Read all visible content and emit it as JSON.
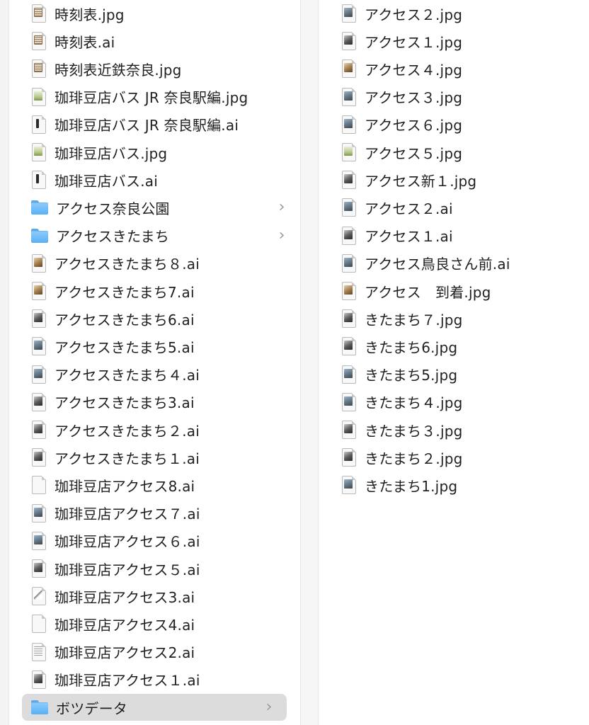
{
  "left_column": {
    "items": [
      {
        "name": "時刻表.jpg",
        "kind": "file",
        "thumb": "table"
      },
      {
        "name": "時刻表.ai",
        "kind": "file",
        "thumb": "table"
      },
      {
        "name": "時刻表近鉄奈良.jpg",
        "kind": "file",
        "thumb": "table"
      },
      {
        "name": "珈琲豆店バス JR 奈良駅編.jpg",
        "kind": "file",
        "thumb": "green"
      },
      {
        "name": "珈琲豆店バス JR 奈良駅編.ai",
        "kind": "file",
        "thumb": "bar"
      },
      {
        "name": "珈琲豆店バス.jpg",
        "kind": "file",
        "thumb": "green"
      },
      {
        "name": "珈琲豆店バス.ai",
        "kind": "file",
        "thumb": "bar"
      },
      {
        "name": "アクセス奈良公園",
        "kind": "folder",
        "chevron": "›"
      },
      {
        "name": "アクセスきたまち",
        "kind": "folder",
        "chevron": "›"
      },
      {
        "name": "アクセスきたまち８.ai",
        "kind": "file",
        "thumb": "tan"
      },
      {
        "name": "アクセスきたまち7.ai",
        "kind": "file",
        "thumb": "tan"
      },
      {
        "name": "アクセスきたまち6.ai",
        "kind": "file",
        "thumb": "dark"
      },
      {
        "name": "アクセスきたまち5.ai",
        "kind": "file",
        "thumb": "photo"
      },
      {
        "name": "アクセスきたまち４.ai",
        "kind": "file",
        "thumb": "photo"
      },
      {
        "name": "アクセスきたまち3.ai",
        "kind": "file",
        "thumb": "dark"
      },
      {
        "name": "アクセスきたまち２.ai",
        "kind": "file",
        "thumb": "dark"
      },
      {
        "name": "アクセスきたまち１.ai",
        "kind": "file",
        "thumb": "dark"
      },
      {
        "name": "珈琲豆店アクセス8.ai",
        "kind": "file",
        "thumb": "blank"
      },
      {
        "name": "珈琲豆店アクセス７.ai",
        "kind": "file",
        "thumb": "photo"
      },
      {
        "name": "珈琲豆店アクセス６.ai",
        "kind": "file",
        "thumb": "photo"
      },
      {
        "name": "珈琲豆店アクセス５.ai",
        "kind": "file",
        "thumb": "dark"
      },
      {
        "name": "珈琲豆店アクセス3.ai",
        "kind": "file",
        "thumb": "sketch"
      },
      {
        "name": "珈琲豆店アクセス4.ai",
        "kind": "file",
        "thumb": "blank"
      },
      {
        "name": "珈琲豆店アクセス2.ai",
        "kind": "file",
        "thumb": "lines"
      },
      {
        "name": "珈琲豆店アクセス１.ai",
        "kind": "file",
        "thumb": "dark"
      },
      {
        "name": "ボツデータ",
        "kind": "folder",
        "chevron": "›",
        "selected": true
      }
    ]
  },
  "right_column": {
    "items": [
      {
        "name": "アクセス２.jpg",
        "kind": "file",
        "thumb": "photo"
      },
      {
        "name": "アクセス１.jpg",
        "kind": "file",
        "thumb": "dark"
      },
      {
        "name": "アクセス４.jpg",
        "kind": "file",
        "thumb": "tan"
      },
      {
        "name": "アクセス３.jpg",
        "kind": "file",
        "thumb": "photo"
      },
      {
        "name": "アクセス６.jpg",
        "kind": "file",
        "thumb": "photo"
      },
      {
        "name": "アクセス５.jpg",
        "kind": "file",
        "thumb": "green"
      },
      {
        "name": "アクセス新１.jpg",
        "kind": "file",
        "thumb": "dark"
      },
      {
        "name": "アクセス２.ai",
        "kind": "file",
        "thumb": "photo"
      },
      {
        "name": "アクセス１.ai",
        "kind": "file",
        "thumb": "dark"
      },
      {
        "name": "アクセス鳥良さん前.ai",
        "kind": "file",
        "thumb": "photo"
      },
      {
        "name": "アクセス　到着.jpg",
        "kind": "file",
        "thumb": "tan"
      },
      {
        "name": "きたまち７.jpg",
        "kind": "file",
        "thumb": "dark"
      },
      {
        "name": "きたまち6.jpg",
        "kind": "file",
        "thumb": "dark"
      },
      {
        "name": "きたまち5.jpg",
        "kind": "file",
        "thumb": "photo"
      },
      {
        "name": "きたまち４.jpg",
        "kind": "file",
        "thumb": "photo"
      },
      {
        "name": "きたまち３.jpg",
        "kind": "file",
        "thumb": "dark"
      },
      {
        "name": "きたまち２.jpg",
        "kind": "file",
        "thumb": "dark"
      },
      {
        "name": "きたまち1.jpg",
        "kind": "file",
        "thumb": "photo"
      }
    ]
  },
  "colors": {
    "folder": "#58b0f5",
    "selection": "#dcdcdc",
    "chevron": "#9a9a9a",
    "text": "#1f1f1f"
  }
}
